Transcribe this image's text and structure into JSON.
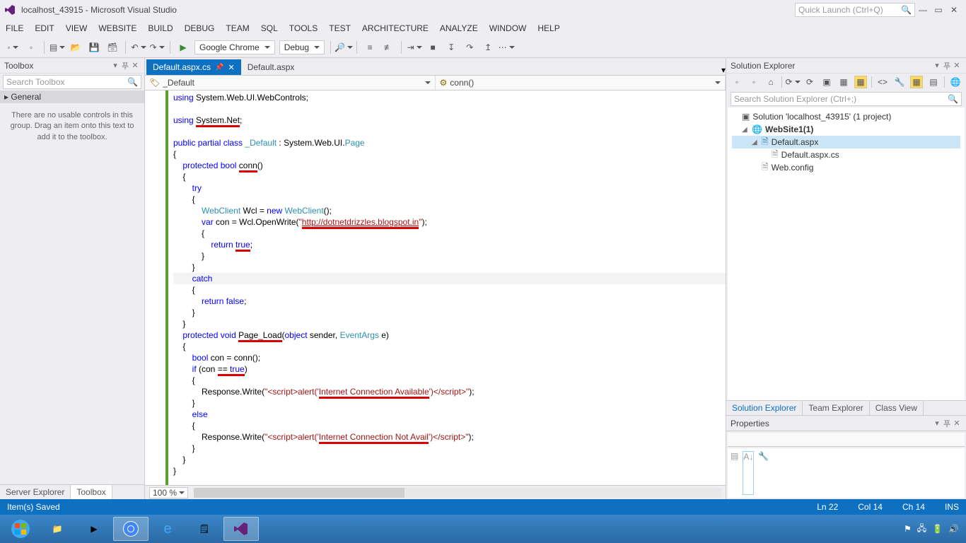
{
  "title": "localhost_43915 - Microsoft Visual Studio",
  "quicklaunch_placeholder": "Quick Launch (Ctrl+Q)",
  "menubar": [
    "FILE",
    "EDIT",
    "VIEW",
    "WEBSITE",
    "BUILD",
    "DEBUG",
    "TEAM",
    "SQL",
    "TOOLS",
    "TEST",
    "ARCHITECTURE",
    "ANALYZE",
    "WINDOW",
    "HELP"
  ],
  "toolbar": {
    "browser": "Google Chrome",
    "config": "Debug"
  },
  "toolbox": {
    "title": "Toolbox",
    "search_placeholder": "Search Toolbox",
    "group": "General",
    "empty": "There are no usable controls in this group. Drag an item onto this text to add it to the toolbox."
  },
  "left_tabs": [
    "Server Explorer",
    "Toolbox"
  ],
  "doctabs": [
    {
      "label": "Default.aspx.cs",
      "active": true,
      "pinned": true
    },
    {
      "label": "Default.aspx",
      "active": false
    }
  ],
  "nav": {
    "left": "_Default",
    "right": "conn()"
  },
  "code_lines": [
    "using System.Web.UI.WebControls;",
    "",
    "using System.Net;",
    "",
    "public partial class _Default : System.Web.UI.Page",
    "{",
    "    protected bool conn()",
    "    {",
    "        try",
    "        {",
    "            WebClient Wcl = new WebClient();",
    "            var con = Wcl.OpenWrite(\"http://dotnetdrizzles.blogspot.in\");",
    "            {",
    "                return true;",
    "            }",
    "        }",
    "        catch",
    "        {",
    "            return false;",
    "        }",
    "    }",
    "    protected void Page_Load(object sender, EventArgs e)",
    "    {",
    "        bool con = conn();",
    "        if (con == true)",
    "        {",
    "            Response.Write(\"<script>alert('Internet Connection Available')</script>\");",
    "        }",
    "        else",
    "        {",
    "            Response.Write(\"<script>alert('Internet Connection Not Avail')</script>\");",
    "        }",
    "    }",
    "}"
  ],
  "zoom": "100 %",
  "solution_explorer": {
    "title": "Solution Explorer",
    "search_placeholder": "Search Solution Explorer (Ctrl+;)",
    "solution": "Solution 'localhost_43915' (1 project)",
    "project": "WebSite1(1)",
    "files": [
      "Default.aspx",
      "Default.aspx.cs",
      "Web.config"
    ]
  },
  "right_tabs": [
    "Solution Explorer",
    "Team Explorer",
    "Class View"
  ],
  "properties": {
    "title": "Properties"
  },
  "statusbar": {
    "msg": "Item(s) Saved",
    "ln": "Ln 22",
    "col": "Col 14",
    "ch": "Ch 14",
    "ins": "INS"
  }
}
